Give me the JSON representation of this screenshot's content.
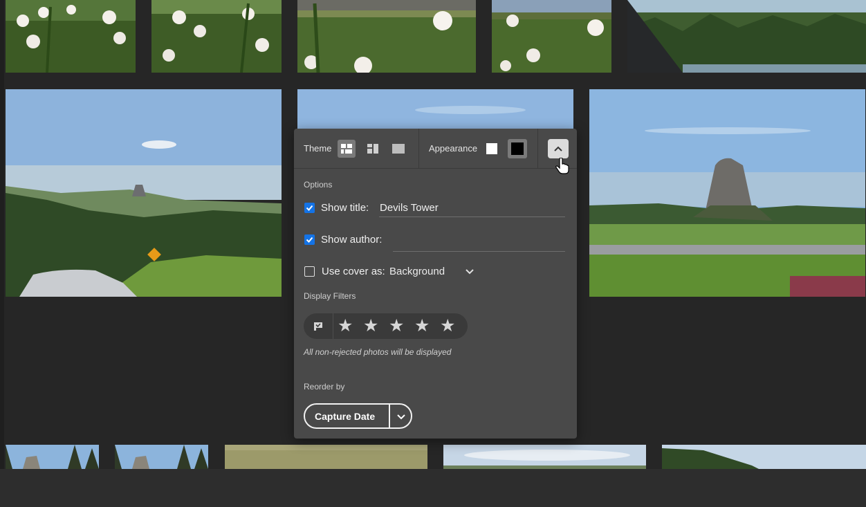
{
  "toolbar": {
    "theme_label": "Theme",
    "appearance_label": "Appearance",
    "icons": [
      "grid-layout-icon",
      "column-layout-icon",
      "single-layout-icon",
      "white-swatch-icon",
      "black-swatch-icon",
      "chevron-up-icon"
    ]
  },
  "options": {
    "section_label": "Options",
    "show_title": {
      "label": "Show title:",
      "checked": true,
      "value": "Devils Tower"
    },
    "show_author": {
      "label": "Show author:",
      "checked": true,
      "value": ""
    },
    "use_cover": {
      "label": "Use cover as:",
      "checked": false,
      "value": "Background"
    }
  },
  "filters": {
    "section_label": "Display Filters",
    "hint": "All non-rejected photos will be displayed",
    "stars": [
      "★",
      "★",
      "★",
      "★",
      "★"
    ]
  },
  "reorder": {
    "section_label": "Reorder by",
    "value": "Capture Date"
  },
  "colors": {
    "panel": "#494949",
    "accent": "#1473e6",
    "background": "#262626"
  }
}
